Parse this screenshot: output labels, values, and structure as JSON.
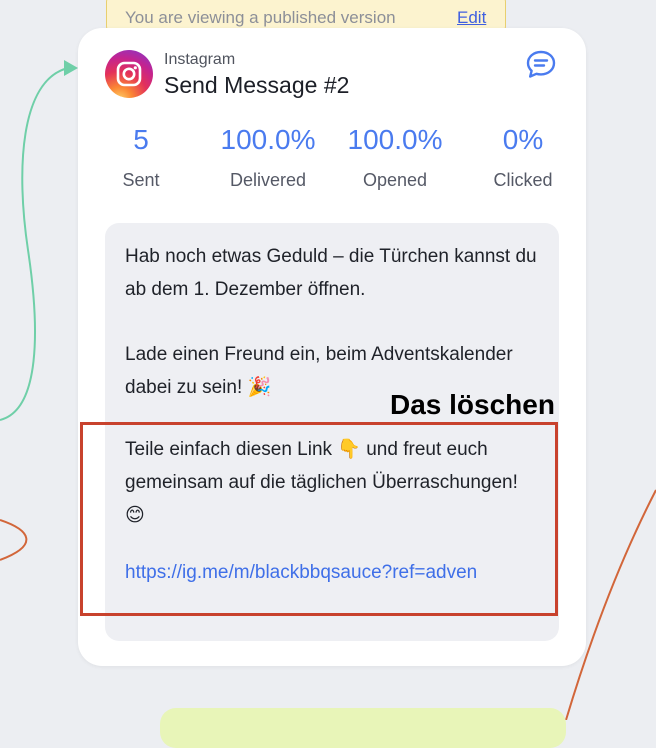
{
  "banner": {
    "text": "You are viewing a published version",
    "edit_label": "Edit"
  },
  "node": {
    "platform": "Instagram",
    "title": "Send Message #2",
    "icon": "instagram-logo",
    "action_icon": "chat-bubble-icon"
  },
  "stats": [
    {
      "value": "5",
      "label": "Sent"
    },
    {
      "value": "100.0%",
      "label": "Delivered"
    },
    {
      "value": "100.0%",
      "label": "Opened"
    },
    {
      "value": "0%",
      "label": "Clicked"
    }
  ],
  "message": {
    "paragraph1": "Hab noch etwas Geduld – die Türchen kannst du ab dem 1. Dezember öffnen.",
    "paragraph2": "Lade einen Freund ein, beim Adventskalender dabei zu sein! 🎉",
    "paragraph3": "Teile einfach diesen Link 👇 und freut euch gemeinsam auf die täglichen Überraschungen! 😊",
    "link": "https://ig.me/m/blackbbqsauce?ref=adven"
  },
  "annotation": {
    "text": "Das löschen",
    "color": "#c8422d"
  },
  "colors": {
    "accent": "#4a7bef",
    "link": "#3f6fe8",
    "banner_bg": "#fcf3cf",
    "connector_green": "#6fcfa8",
    "connector_orange": "#d2663a"
  }
}
